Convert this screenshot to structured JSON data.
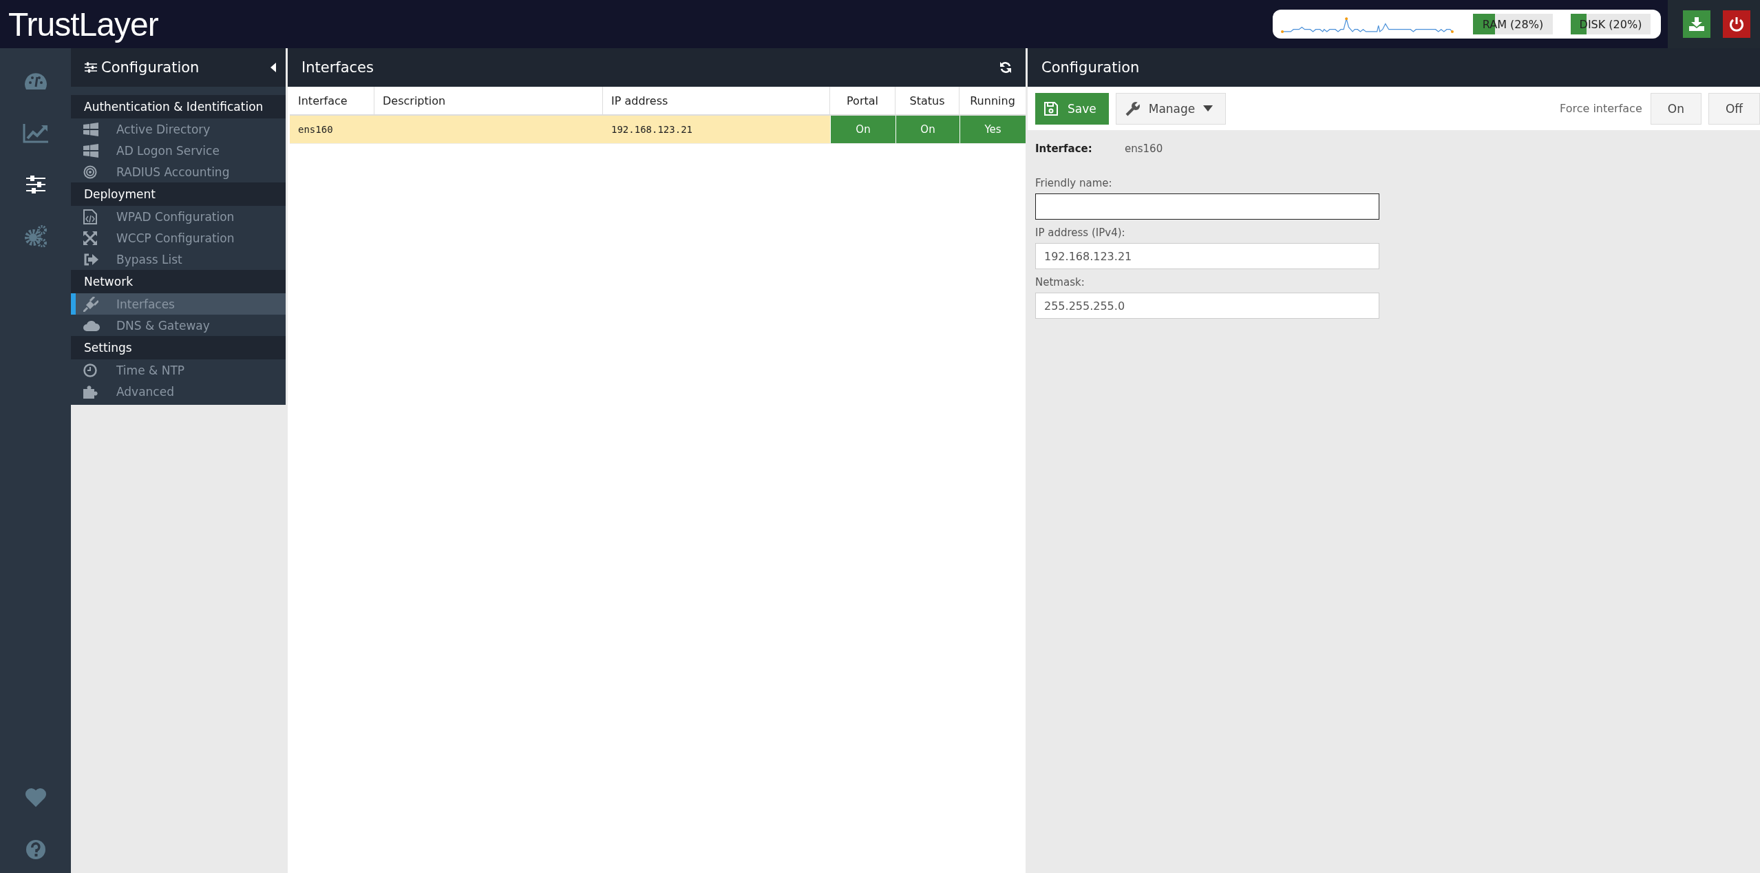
{
  "topbar": {
    "logo": "TrustLayer",
    "meters": [
      {
        "label": "RAM (28%)",
        "level": 0.28
      },
      {
        "label": "DISK (20%)",
        "level": 0.2
      }
    ]
  },
  "rail": {
    "items": [
      {
        "kind": "dashboard",
        "selected": false
      },
      {
        "kind": "chart",
        "selected": false
      },
      {
        "kind": "sliders",
        "selected": true
      },
      {
        "kind": "gears",
        "selected": false
      }
    ],
    "bottom": [
      {
        "kind": "heart",
        "selected": false
      },
      {
        "kind": "help",
        "selected": false
      }
    ]
  },
  "sidebar": {
    "title": "Configuration",
    "groups": [
      {
        "title": "Authentication & Identification",
        "items": [
          {
            "label": "Active Directory",
            "kind": "windows",
            "selected": false
          },
          {
            "label": "AD Logon Service",
            "kind": "windows",
            "selected": false
          },
          {
            "label": "RADIUS Accounting",
            "kind": "target",
            "selected": false
          }
        ]
      },
      {
        "title": "Deployment",
        "items": [
          {
            "label": "WPAD Configuration",
            "kind": "code-file",
            "selected": false
          },
          {
            "label": "WCCP Configuration",
            "kind": "expand",
            "selected": false
          },
          {
            "label": "Bypass List",
            "kind": "exit",
            "selected": false
          }
        ]
      },
      {
        "title": "Network",
        "items": [
          {
            "label": "Interfaces",
            "kind": "plug",
            "selected": true
          },
          {
            "label": "DNS & Gateway",
            "kind": "cloud",
            "selected": false
          }
        ]
      },
      {
        "title": "Settings",
        "items": [
          {
            "label": "Time & NTP",
            "kind": "clock",
            "selected": false
          },
          {
            "label": "Advanced",
            "kind": "puzzle",
            "selected": false
          }
        ]
      }
    ]
  },
  "interfaces": {
    "title": "Interfaces",
    "table": {
      "columns": [
        "Interface",
        "Description",
        "IP address",
        "Portal",
        "Status",
        "Running"
      ],
      "rows": [
        {
          "selected": true,
          "interface": "ens160",
          "ip": "192.168.123.21",
          "portal": "On",
          "status": "On",
          "running": "Yes"
        }
      ]
    }
  },
  "configuration": {
    "title": "Configuration",
    "save": "Save",
    "manage": "Manage",
    "force_interface": {
      "label": "Force interface",
      "options": [
        {
          "label": "On",
          "selected": false
        },
        {
          "label": "Off",
          "selected": false
        }
      ]
    },
    "interface_label": "Interface:",
    "interface_value": "ens160",
    "fields": [
      {
        "label": "Friendly name:",
        "focused": true
      },
      {
        "label": "IP address (IPv4):",
        "value": "192.168.123.21",
        "focused": false
      },
      {
        "label": "Netmask:",
        "value": "255.255.255.0",
        "focused": false
      }
    ]
  }
}
